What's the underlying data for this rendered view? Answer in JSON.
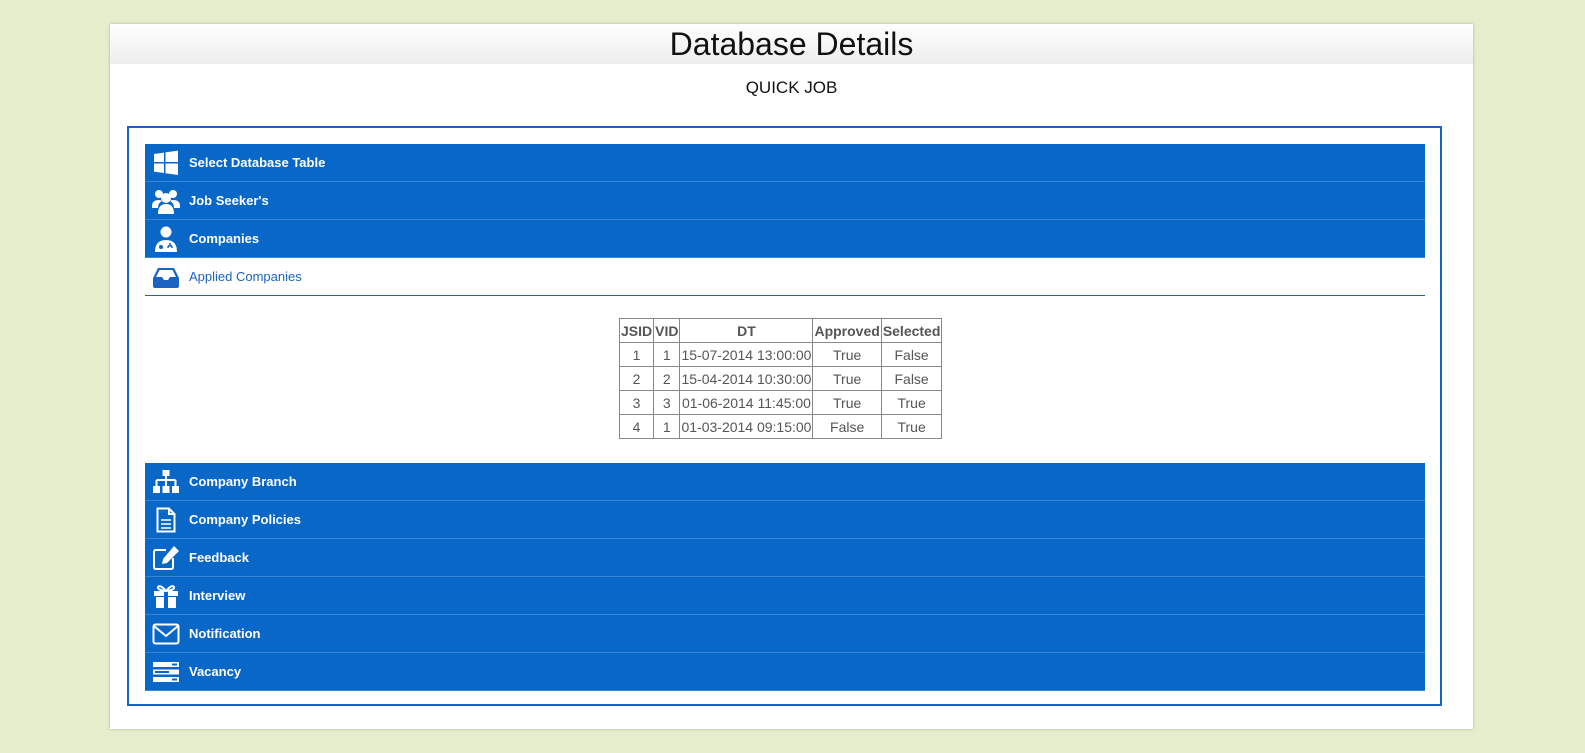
{
  "header": {
    "title": "Database Details",
    "subtitle": "QUICK JOB"
  },
  "menu": {
    "items": [
      {
        "label": "Select Database Table",
        "icon": "windows-icon"
      },
      {
        "label": "Job Seeker's",
        "icon": "users-icon"
      },
      {
        "label": "Companies",
        "icon": "user-doctor-icon"
      },
      {
        "label": "Applied Companies",
        "icon": "inbox-icon",
        "active": true
      },
      {
        "label": "Company Branch",
        "icon": "sitemap-icon"
      },
      {
        "label": "Company Policies",
        "icon": "document-icon"
      },
      {
        "label": "Feedback",
        "icon": "edit-icon"
      },
      {
        "label": "Interview",
        "icon": "gift-icon"
      },
      {
        "label": "Notification",
        "icon": "envelope-icon"
      },
      {
        "label": "Vacancy",
        "icon": "server-icon"
      }
    ]
  },
  "table": {
    "headers": [
      "JSID",
      "VID",
      "DT",
      "Approved",
      "Selected"
    ],
    "rows": [
      [
        "1",
        "1",
        "15-07-2014 13:00:00",
        "True",
        "False"
      ],
      [
        "2",
        "2",
        "15-04-2014 10:30:00",
        "True",
        "False"
      ],
      [
        "3",
        "3",
        "01-06-2014 11:45:00",
        "True",
        "True"
      ],
      [
        "4",
        "1",
        "01-03-2014 09:15:00",
        "False",
        "True"
      ]
    ]
  },
  "colors": {
    "page_bg": "#e5eecc",
    "accent": "#0967c8",
    "frame": "#1a63c2"
  }
}
